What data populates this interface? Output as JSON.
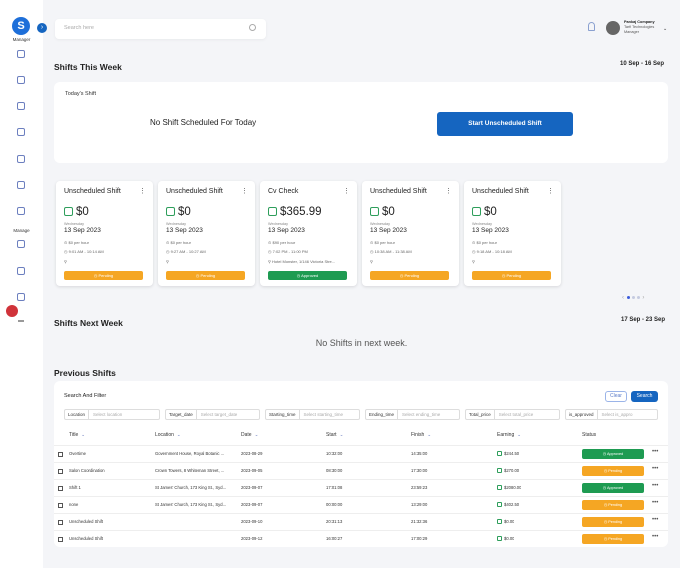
{
  "sidebar": {
    "logo": "S",
    "top_label": "Manager",
    "section_label": "Manage",
    "icons": [
      "dashboard-icon",
      "users-icon",
      "document-icon",
      "shield-icon",
      "calendar-icon",
      "team-icon",
      "report-icon",
      "people-icon",
      "box-icon",
      "chart-icon",
      "settings-icon"
    ]
  },
  "header": {
    "search_placeholder": "Search here",
    "user": {
      "name": "Pankaj Company",
      "company": "Tarfi Technologies",
      "role": "Manager"
    }
  },
  "this_week": {
    "title": "Shifts This Week",
    "range": "10 Sep - 16 Sep",
    "today_label": "Today's Shift",
    "no_shift": "No Shift Scheduled For Today",
    "start_button": "Start Unscheduled Shift"
  },
  "cards": [
    {
      "title": "Unscheduled Shift",
      "amount": "$0",
      "weekday": "Wednesday",
      "date": "13 Sep 2023",
      "rate": "$0 per hour",
      "time": "9:01 AM - 10:14 AM",
      "location": "",
      "status": "Pending"
    },
    {
      "title": "Unscheduled Shift",
      "amount": "$0",
      "weekday": "Wednesday",
      "date": "13 Sep 2023",
      "rate": "$0 per hour",
      "time": "9:27 AM - 10:27 AM",
      "location": "",
      "status": "Pending"
    },
    {
      "title": "Cv Check",
      "amount": "$365.99",
      "weekday": "Wednesday",
      "date": "13 Sep 2023",
      "rate": "$90 per hour",
      "time": "7:02 PM - 11:00 PM",
      "location": "Hotel Monster, 1/146 Victoria Stre...",
      "status": "Approved"
    },
    {
      "title": "Unscheduled Shift",
      "amount": "$0",
      "weekday": "Wednesday",
      "date": "13 Sep 2023",
      "rate": "$0 per hour",
      "time": "10:38 AM - 11:38 AM",
      "location": "",
      "status": "Pending"
    },
    {
      "title": "Unscheduled Shift",
      "amount": "$0",
      "weekday": "Wednesday",
      "date": "13 Sep 2023",
      "rate": "$0 per hour",
      "time": "9:18 AM - 10:18 AM",
      "location": "",
      "status": "Pending"
    }
  ],
  "next_week": {
    "title": "Shifts Next Week",
    "range": "17 Sep - 23 Sep",
    "empty": "No Shifts in next week."
  },
  "previous": {
    "title": "Previous Shifts",
    "search_title": "Search And Filter",
    "clear_label": "Clear",
    "search_label": "Search",
    "filters": [
      {
        "key": "Location",
        "placeholder": "Select location"
      },
      {
        "key": "Target_date",
        "placeholder": "Select target_date"
      },
      {
        "key": "Starting_time",
        "placeholder": "Select starting_time"
      },
      {
        "key": "Ending_time",
        "placeholder": "Select ending_time"
      },
      {
        "key": "Total_price",
        "placeholder": "Select total_price"
      },
      {
        "key": "is_approved",
        "placeholder": "Select is_appro"
      }
    ],
    "columns": [
      "Title",
      "Location",
      "Date",
      "Start",
      "Finish",
      "Earning",
      "Status"
    ],
    "rows": [
      {
        "title": "Overtime",
        "location": "Government House, Royal Botanic ...",
        "date": "2023-08-29",
        "start": "10:32:00",
        "finish": "14:35:00",
        "earning": "$244.50",
        "status": "Approved"
      },
      {
        "title": "Salon Coordination",
        "location": "Crown Towers, 8 Whiteman Street, ...",
        "date": "2023-09-05",
        "start": "08:30:00",
        "finish": "17:30:00",
        "earning": "$270.00",
        "status": "Pending"
      },
      {
        "title": "Shift 1",
        "location": "St James' Church, 173 King St., Syd...",
        "date": "2023-09-07",
        "start": "17:01:08",
        "finish": "23:59:23",
        "earning": "$2080.00",
        "status": "Approved"
      },
      {
        "title": "none",
        "location": "St James' Church, 173 King St., Syd...",
        "date": "2023-09-07",
        "start": "00:00:00",
        "finish": "13:29:00",
        "earning": "$402.50",
        "status": "Pending"
      },
      {
        "title": "Unscheduled Shift",
        "location": "",
        "date": "2023-09-10",
        "start": "20:31:13",
        "finish": "21:32:36",
        "earning": "$0.00",
        "status": "Pending"
      },
      {
        "title": "Unscheduled Shift",
        "location": "",
        "date": "2023-09-12",
        "start": "16:00:27",
        "finish": "17:00:29",
        "earning": "$0.00",
        "status": "Pending"
      }
    ]
  }
}
